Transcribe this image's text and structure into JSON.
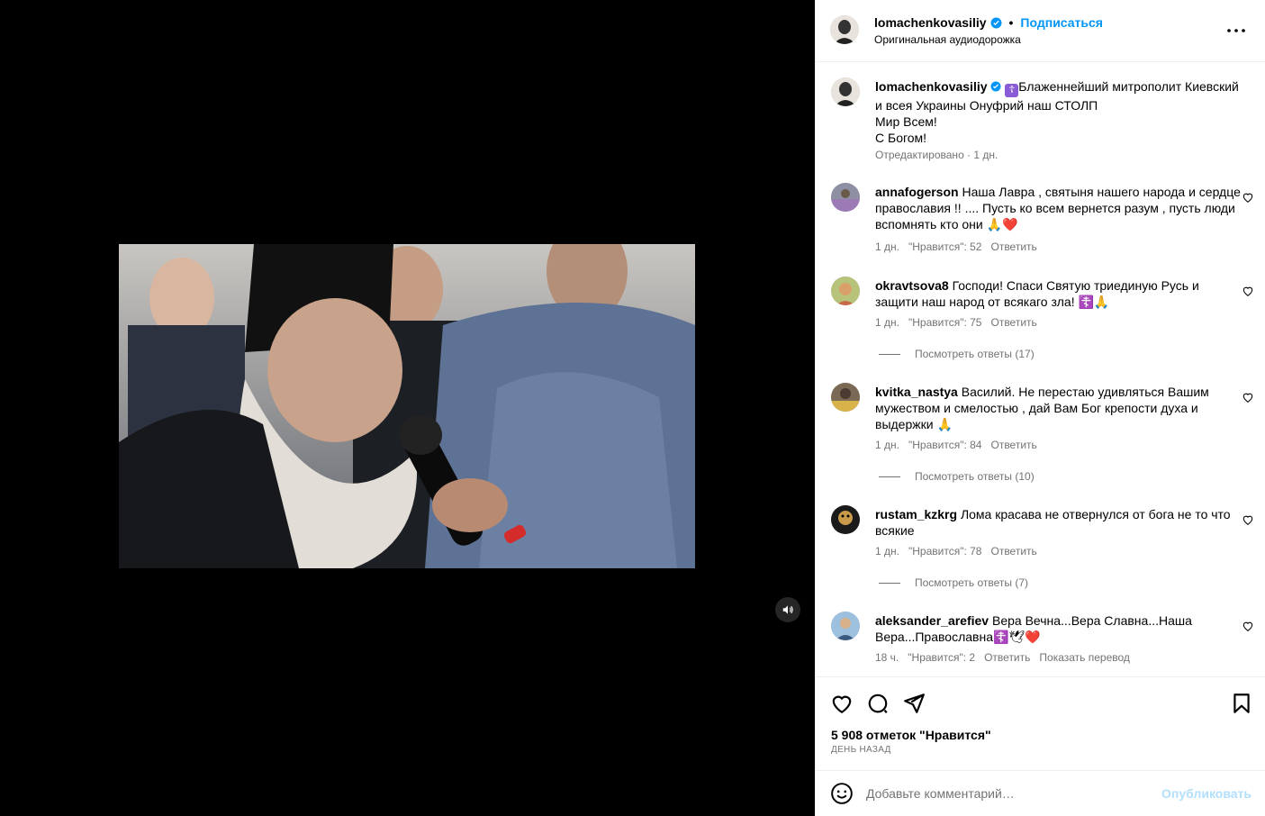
{
  "post": {
    "author": "lomachenkovasiliy",
    "follow_label": "Подписаться",
    "separator": "•",
    "audio": "Оригинальная аудиодорожка",
    "caption_lines": [
      "Блаженнейший митрополит Киевский",
      "и всея Украины Онуфрий наш СТОЛП",
      "Мир Всем!",
      "С Богом!"
    ],
    "caption_meta": "Отредактировано · 1 дн."
  },
  "comments": [
    {
      "user": "annafogerson",
      "text": "Наша Лавра , святыня нашего народа и сердце православия !! .... Пусть ко всем вернется разум , пусть люди вспомнять кто они 🙏❤️",
      "time": "1 дн.",
      "likes": "\"Нравится\": 52",
      "reply": "Ответить"
    },
    {
      "user": "okravtsova8",
      "text": "Господи! Спаси Святую триединую Русь и защити наш народ от всякаго зла! ☦️🙏",
      "time": "1 дн.",
      "likes": "\"Нравится\": 75",
      "reply": "Ответить",
      "replies": "Посмотреть ответы (17)"
    },
    {
      "user": "kvitka_nastya",
      "text": "Василий. Не перестаю удивляться Вашим мужеством и смелостью , дай Вам Бог крепости духа и выдержки 🙏",
      "time": "1 дн.",
      "likes": "\"Нравится\": 84",
      "reply": "Ответить",
      "replies": "Посмотреть ответы (10)"
    },
    {
      "user": "rustam_kzkrg",
      "text": "Лома красава не отвернулся от бога не то что всякие",
      "time": "1 дн.",
      "likes": "\"Нравится\": 78",
      "reply": "Ответить",
      "replies": "Посмотреть ответы (7)"
    },
    {
      "user": "aleksander_arefiev",
      "text": "Вера Вечна...Вера Славна...Наша Вера...Православна☦️🕊❤️",
      "time": "18 ч.",
      "likes": "\"Нравится\": 2",
      "reply": "Ответить",
      "translate": "Показать перевод"
    }
  ],
  "stats": {
    "likes": "5 908 отметок \"Нравится\"",
    "date": "ДЕНЬ НАЗАД"
  },
  "composer": {
    "placeholder": "Добавьте комментарий…",
    "publish": "Опубликовать"
  },
  "colors": {
    "accent": "#0095f6",
    "verified": "#0095f6",
    "muted": "#737373",
    "publish_disabled": "#b2dffc"
  }
}
